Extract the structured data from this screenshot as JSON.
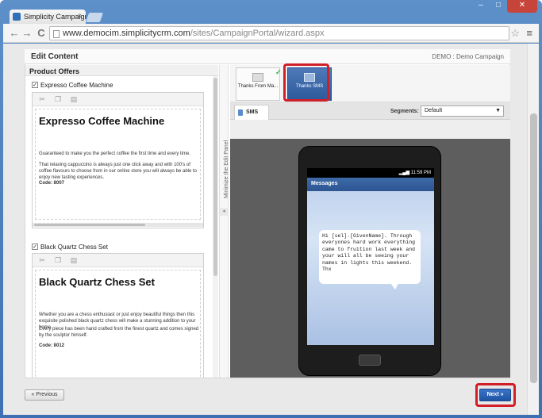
{
  "browser": {
    "tab_title": "Simplicity Campaign Port",
    "tab_close": "×",
    "url_host": "www.democim.simplicitycrm.com",
    "url_path": "/sites/CampaignPortal/wizard.aspx",
    "back": "←",
    "forward": "→",
    "reload": "C",
    "star": "☆",
    "menu": "≡",
    "minimize": "–",
    "maximize": "□",
    "close": "✕"
  },
  "header": {
    "title": "Edit Content",
    "context": "DEMO : Demo Campaign"
  },
  "left_panel": {
    "title": "Product Offers",
    "products": [
      {
        "label": "Expresso Coffee Machine",
        "heading": "Expresso Coffee Machine",
        "line1": "Guaranteed to make you the perfect coffee the first time and every time.",
        "line2": "That relaxing cappuccino is always just one click away and with 100's of coffee flavours to choose from in our online store you will always be able to enjoy new tasting experiences.",
        "code": "Code: 8007",
        "checked": true
      },
      {
        "label": "Black Quartz Chess Set",
        "heading": "Black Quartz Chess Set",
        "line1": "Whether you are a chess enthusiast or just enjoy beautiful things then this exquisite polished black quartz chess will make a stunning addition to your home.",
        "line2": "Every piece has been hand crafted from the finest quartz and comes signed by the sculptor himself.",
        "code": "Code: 8012",
        "checked": true
      }
    ],
    "editor_tools": [
      "cut-icon",
      "copy-icon",
      "paste-icon"
    ],
    "minimize_label": "Minimize the Edit Panel"
  },
  "right_panel": {
    "tiles": [
      {
        "label": "Thanks From Ma...",
        "icon": "email-icon",
        "done": true,
        "active": false
      },
      {
        "label": "Thanks SMS",
        "icon": "sms-icon",
        "done": true,
        "active": true
      }
    ],
    "tab": "SMS",
    "segments_label": "Segments:",
    "segments_value": "Default",
    "phone": {
      "status_time": "11:59 PM",
      "app_title": "Messages",
      "message": "Hi [sel].[GivenName]. Through everyones hard work everything came to fruition last week and your will all be seeing your names in lights this weekend. Thx"
    }
  },
  "footer": {
    "prev": "« Previous",
    "next": "Next »"
  },
  "colors": {
    "highlight": "#d11f2a",
    "accent": "#2c5a9c"
  }
}
